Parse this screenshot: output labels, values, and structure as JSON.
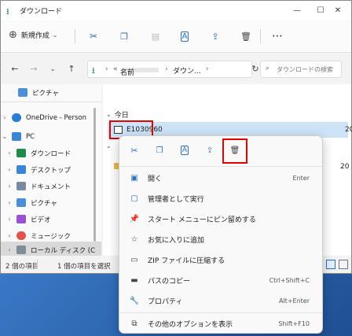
{
  "window": {
    "title": "ダウンロード"
  },
  "toolbar": {
    "new_label": "新規作成"
  },
  "address": {
    "path_prefix": "«",
    "path_text": "ダウン...",
    "search_placeholder": "ダウンロードの検索"
  },
  "nav": {
    "items": [
      {
        "label": "ピクチャ",
        "color": "#4a8fd8"
      },
      {
        "label": "OneDrive - Person",
        "color": "#2b7cd3"
      },
      {
        "label": "PC",
        "color": "#3a86d4"
      },
      {
        "label": "ダウンロード",
        "color": "#1f8a4c"
      },
      {
        "label": "デスクトップ",
        "color": "#3a86d4"
      },
      {
        "label": "ドキュメント",
        "color": "#7a8aa0"
      },
      {
        "label": "ピクチャ",
        "color": "#4a8fd8"
      },
      {
        "label": "ビデオ",
        "color": "#9b4fd1"
      },
      {
        "label": "ミュージック",
        "color": "#e0524a"
      },
      {
        "label": "ローカル ディスク (C",
        "color": "#7f8c99"
      }
    ]
  },
  "content": {
    "column_name": "名前",
    "group_today": "今日",
    "file_name": "E1030960",
    "date_frag1": "20",
    "date_frag2": "20"
  },
  "status": {
    "items_count": "2 個の項目",
    "selected": "1 個の項目を選択"
  },
  "context_menu": {
    "items": [
      {
        "label": "開く",
        "shortcut": "Enter"
      },
      {
        "label": "管理者として実行",
        "shortcut": ""
      },
      {
        "label": "スタート メニューにピン留めする",
        "shortcut": ""
      },
      {
        "label": "お気に入りに追加",
        "shortcut": ""
      },
      {
        "label": "ZIP ファイルに圧縮する",
        "shortcut": ""
      },
      {
        "label": "パスのコピー",
        "shortcut": "Ctrl+Shift+C"
      },
      {
        "label": "プロパティ",
        "shortcut": "Alt+Enter"
      },
      {
        "label": "その他のオプションを表示",
        "shortcut": "Shift+F10"
      }
    ]
  }
}
